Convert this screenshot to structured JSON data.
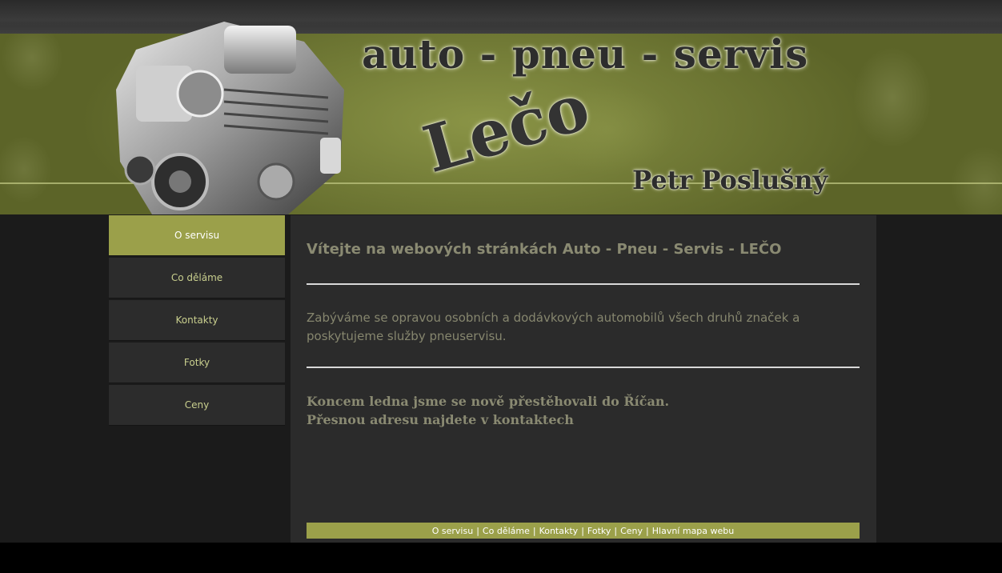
{
  "header": {
    "title": "auto - pneu - servis",
    "brand": "Lečo",
    "owner": "Petr Poslušný"
  },
  "nav": {
    "items": [
      {
        "label": "O servisu",
        "active": true
      },
      {
        "label": "Co děláme"
      },
      {
        "label": "Kontakty"
      },
      {
        "label": "Fotky"
      },
      {
        "label": "Ceny"
      }
    ]
  },
  "content": {
    "headline": "Vítejte na webových stránkách Auto - Pneu - Servis - LEČO",
    "intro": "Zabýváme se opravou osobních a dodávkových automobilů všech druhů značek a poskytujeme služby pneuservisu.",
    "news_line1": "Koncem ledna jsme se nově přestěhovali do Říčan.",
    "news_line2": "Přesnou adresu najdete v kontaktech"
  },
  "footer": {
    "links": [
      "O servisu",
      "Co děláme",
      "Kontakty",
      "Fotky",
      "Ceny",
      "Hlavní mapa webu"
    ],
    "separator": "|"
  },
  "colors": {
    "accent": "#9ba04a",
    "nav_text": "#c9cf8e",
    "body_text": "#86866e"
  }
}
